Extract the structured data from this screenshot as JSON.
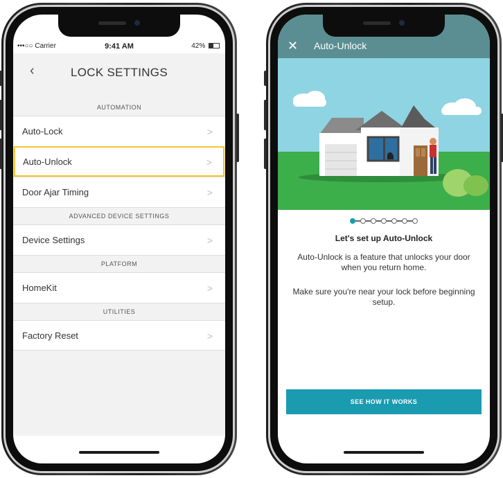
{
  "left_screen": {
    "status_bar": {
      "carrier": "•••○○ Carrier",
      "time": "9:41 AM",
      "battery": "42%"
    },
    "header": {
      "back_icon": "chevron-left-icon",
      "title": "LOCK SETTINGS"
    },
    "sections": [
      {
        "heading": "AUTOMATION",
        "rows": [
          {
            "label": "Auto-Lock",
            "highlighted": false
          },
          {
            "label": "Auto-Unlock",
            "highlighted": true
          },
          {
            "label": "Door Ajar Timing",
            "highlighted": false
          }
        ]
      },
      {
        "heading": "ADVANCED DEVICE SETTINGS",
        "rows": [
          {
            "label": "Device Settings",
            "highlighted": false
          }
        ]
      },
      {
        "heading": "PLATFORM",
        "rows": [
          {
            "label": "HomeKit",
            "highlighted": false
          }
        ]
      },
      {
        "heading": "UTILITIES",
        "rows": [
          {
            "label": "Factory Reset",
            "highlighted": false
          }
        ]
      }
    ],
    "chevron_glyph": ">",
    "highlight_color": "#f4c430"
  },
  "right_screen": {
    "header": {
      "close_icon": "close-icon",
      "title": "Auto-Unlock",
      "background_color": "#5b8e92"
    },
    "progress": {
      "steps": 7,
      "current": 1
    },
    "setup_title": "Let's set up Auto-Unlock",
    "description": "Auto-Unlock is a feature that unlocks your door when you return home.",
    "note": "Make sure you're near your lock before beginning setup.",
    "cta_label": "SEE HOW IT WORKS",
    "accent_color": "#1a9bb0"
  }
}
